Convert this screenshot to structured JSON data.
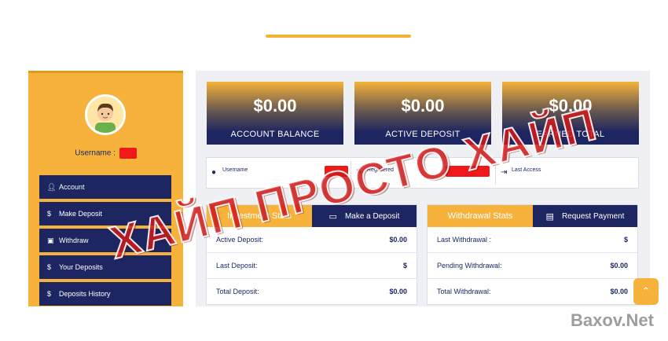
{
  "sidebar": {
    "username_label": "Username :",
    "menu": [
      {
        "label": "Account",
        "icon": "user-icon"
      },
      {
        "label": "Make Deposit",
        "icon": "dollar-icon"
      },
      {
        "label": "Withdraw",
        "icon": "wallet-icon"
      },
      {
        "label": "Your Deposits",
        "icon": "dollar-icon"
      },
      {
        "label": "Deposits History",
        "icon": "dollar-icon"
      }
    ]
  },
  "stats": [
    {
      "value": "$0.00",
      "label": "ACCOUNT BALANCE"
    },
    {
      "value": "$0.00",
      "label": "ACTIVE DEPOSIT"
    },
    {
      "value": "$0.00",
      "label": "EARNED TOTAL"
    }
  ],
  "info": {
    "username": "Username",
    "registered": "Registered",
    "last_access": "Last Access"
  },
  "investment": {
    "title": "Investment Stats",
    "action": "Make a Deposit",
    "rows": [
      {
        "label": "Active Deposit:",
        "value": "$0.00"
      },
      {
        "label": "Last Deposit:",
        "value": "$"
      },
      {
        "label": "Total Deposit:",
        "value": "$0.00"
      }
    ]
  },
  "withdrawal": {
    "title": "Withdrawal Stats",
    "action": "Request Payment",
    "rows": [
      {
        "label": "Last Withdrawal :",
        "value": "$"
      },
      {
        "label": "Pending Withdrawal:",
        "value": "$0.00"
      },
      {
        "label": "Total Withdrawal:",
        "value": "$0.00"
      }
    ]
  },
  "scroll_top_icon": "chevron-up-icon",
  "watermark": "ХАЙП ПРОСТО ХАЙП",
  "site_watermark": "Baxov.Net",
  "colors": {
    "accent": "#f6b23a",
    "navy": "#1d2660",
    "redaction": "#f01919"
  }
}
